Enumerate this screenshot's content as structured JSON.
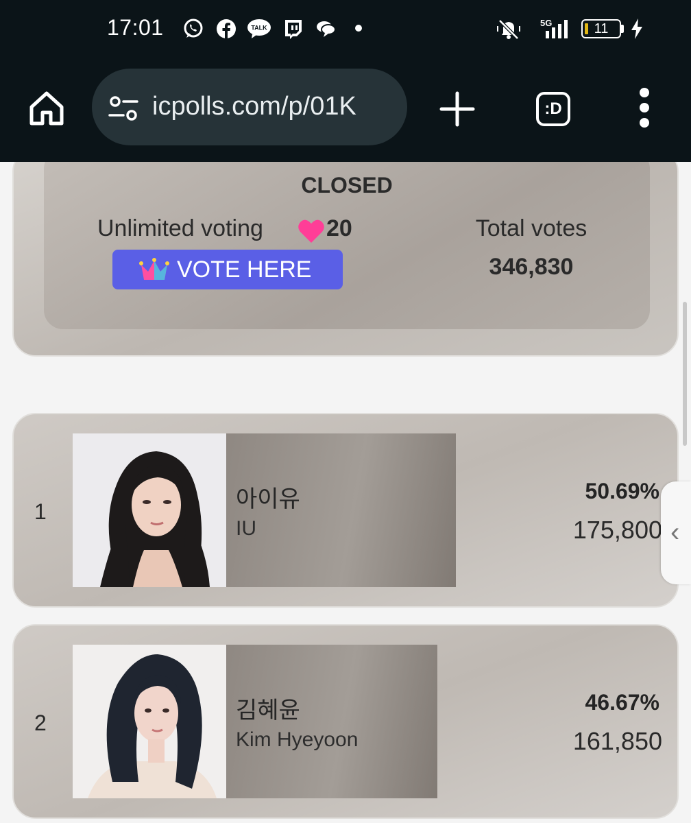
{
  "status_bar": {
    "time": "17:01",
    "notification_icons": [
      "whatsapp-icon",
      "facebook-icon",
      "kakaotalk-icon",
      "twitch-icon",
      "chat-bubble-icon"
    ],
    "kakaotalk_label": "TALK",
    "network": "5G",
    "battery": "11",
    "battery_color": "#e2b714"
  },
  "browser": {
    "url": "icpolls.com/p/01K",
    "tab_icon_label": ":D"
  },
  "poll": {
    "status": "CLOSED",
    "voting_mode": "Unlimited voting",
    "heart_count": "20",
    "vote_button": "VOTE HERE",
    "total_votes_label": "Total votes",
    "total_votes": "346,830",
    "accent_color": "#5a5fe6",
    "heart_color": "#ff3d97"
  },
  "candidates": [
    {
      "rank": "1",
      "name_ko": "아이유",
      "name_en": "IU",
      "percent": "50.69%",
      "votes": "175,800",
      "share": 0.5069
    },
    {
      "rank": "2",
      "name_ko": "김혜윤",
      "name_en": "Kim Hyeyoon",
      "percent": "46.67%",
      "votes": "161,850",
      "share": 0.4667
    }
  ]
}
